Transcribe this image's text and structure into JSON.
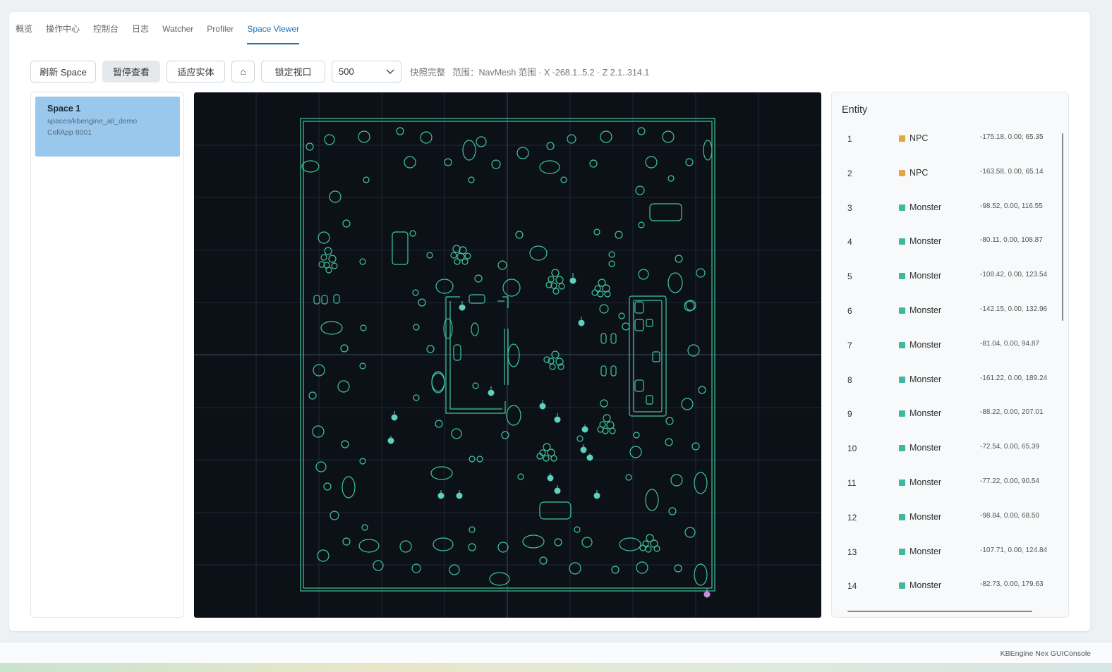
{
  "tabs": [
    {
      "label": "概览",
      "active": false
    },
    {
      "label": "操作中心",
      "active": false
    },
    {
      "label": "控制台",
      "active": false
    },
    {
      "label": "日志",
      "active": false
    },
    {
      "label": "Watcher",
      "active": false
    },
    {
      "label": "Profiler",
      "active": false
    },
    {
      "label": "Space Viewer",
      "active": true
    }
  ],
  "toolbar": {
    "refresh_label": "刷新 Space",
    "pause_label": "暂停查看",
    "fit_label": "适应实体",
    "home_label": "⌂",
    "lock_label": "锁定视口",
    "select_value": "500",
    "status_text": "快照完整",
    "range_text": "范围：NavMesh 范围 · X -268.1..5.2 · Z 2.1..314.1"
  },
  "spaces": [
    {
      "name": "Space 1",
      "path": "spaces/kbengine_all_demo",
      "cellapp": "CellApp 8001"
    }
  ],
  "entity_panel": {
    "title": "Entity",
    "entities": [
      {
        "id": "1",
        "type": "NPC",
        "pos": "-175.18, 0.00, 65.35"
      },
      {
        "id": "2",
        "type": "NPC",
        "pos": "-163.58, 0.00, 65.14"
      },
      {
        "id": "3",
        "type": "Monster",
        "pos": "-98.52, 0.00, 116.55"
      },
      {
        "id": "4",
        "type": "Monster",
        "pos": "-80.11, 0.00, 108.87"
      },
      {
        "id": "5",
        "type": "Monster",
        "pos": "-108.42, 0.00, 123.54"
      },
      {
        "id": "6",
        "type": "Monster",
        "pos": "-142.15, 0.00, 132.96"
      },
      {
        "id": "7",
        "type": "Monster",
        "pos": "-81.04, 0.00, 94.87"
      },
      {
        "id": "8",
        "type": "Monster",
        "pos": "-161.22, 0.00, 189.24"
      },
      {
        "id": "9",
        "type": "Monster",
        "pos": "-88.22, 0.00, 207.01"
      },
      {
        "id": "10",
        "type": "Monster",
        "pos": "-72.54, 0.00, 65.39"
      },
      {
        "id": "11",
        "type": "Monster",
        "pos": "-77.22, 0.00, 90.54"
      },
      {
        "id": "12",
        "type": "Monster",
        "pos": "-98.84, 0.00, 68.50"
      },
      {
        "id": "13",
        "type": "Monster",
        "pos": "-107.71, 0.00, 124.84"
      },
      {
        "id": "14",
        "type": "Monster",
        "pos": "-82.73, 0.00, 179.63"
      }
    ]
  },
  "colors": {
    "npc": "#e3a646",
    "monster": "#3fb8a0",
    "navmesh": "#3fc6a0",
    "viewer_bg": "#0c1117",
    "accent": "#1f6fb2",
    "player": "#c58fd8"
  },
  "footer": {
    "text": "KBEngine Nex GUIConsole"
  }
}
